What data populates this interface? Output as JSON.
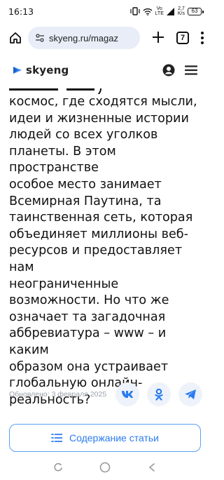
{
  "status_bar": {
    "time": "16:13",
    "network": "Vo LTE",
    "network_top": "Vo",
    "network_bottom": "LTE",
    "speed_value": "2,7",
    "speed_unit": "K/s",
    "battery": "63"
  },
  "browser": {
    "url": "skyeng.ru/magaz",
    "tab_count": "7"
  },
  "site": {
    "brand": "skyeng",
    "accent_color": "#2b7cf0"
  },
  "article": {
    "lines": [
      "космос, где сходятся мысли,",
      "идеи и жизненные истории",
      "людей со всех уголков",
      "планеты. В этом пространстве",
      "особое место занимает",
      "Всемирная Паутина, та",
      "таинственная сеть, которая",
      "объединяет миллионы веб-",
      "ресурсов и предоставляет нам",
      "неограниченные",
      "возможности. Но что же",
      "означает та загадочная",
      "аббревиатура – www – и каким",
      "образом она устраивает",
      "глобальную онлайн-",
      "реальность?"
    ],
    "updated": "Обновлено: 3 февраля 2025",
    "share_icons": [
      "vk-icon",
      "odnoklassniki-icon",
      "telegram-icon"
    ]
  },
  "toc_button": {
    "label": "Содержание статьи"
  }
}
